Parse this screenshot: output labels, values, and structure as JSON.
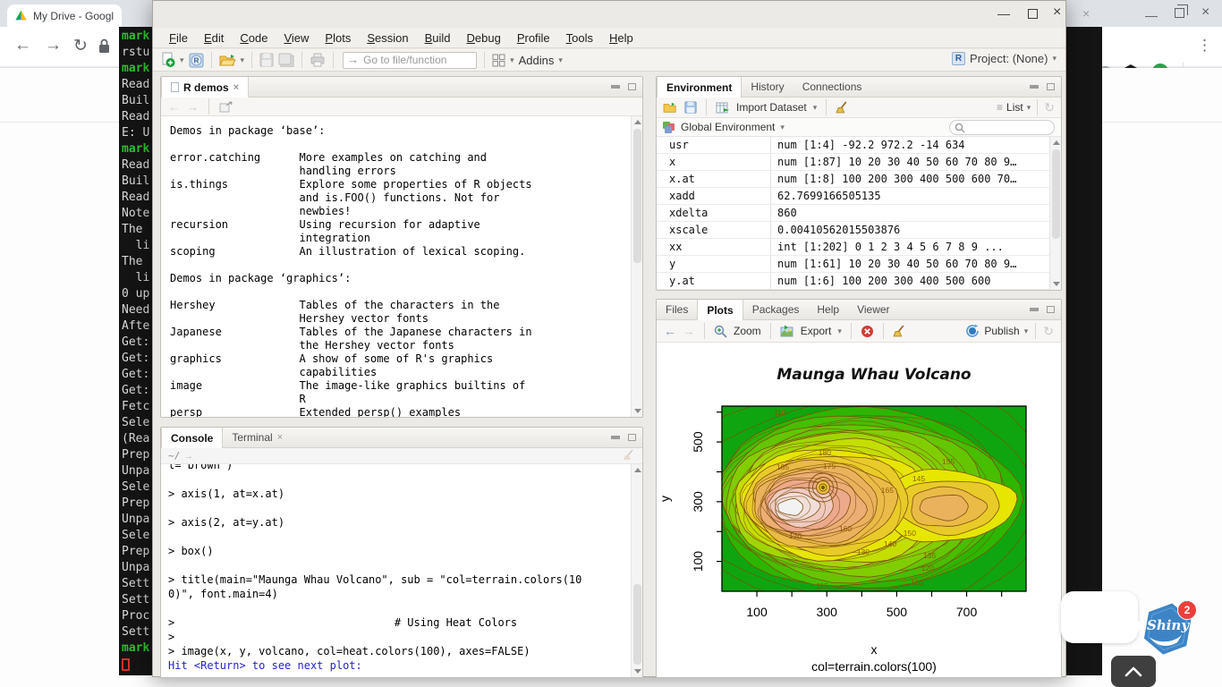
{
  "icons": {
    "back": "←",
    "forward": "→",
    "reload": "↻",
    "refresh": "↻",
    "minimize": "—",
    "close": "×",
    "tab_close": "×",
    "kebab": "⋮",
    "caret": "▾",
    "list": "≡",
    "goto_arrow": "→",
    "prompt_arrow": "→",
    "project_r": "R"
  },
  "browser": {
    "tab_title": "My Drive - Google"
  },
  "terminal": {
    "lines": [
      {
        "text": "mark",
        "color": "g"
      },
      {
        "text": "rstu",
        "color": "w"
      },
      {
        "text": "mark",
        "color": "g"
      },
      {
        "text": "Read",
        "color": "w"
      },
      {
        "text": "Buil",
        "color": "w"
      },
      {
        "text": "Read",
        "color": "w"
      },
      {
        "text": "E: U",
        "color": "w"
      },
      {
        "text": "mark",
        "color": "g"
      },
      {
        "text": "Read",
        "color": "w"
      },
      {
        "text": "Buil",
        "color": "w"
      },
      {
        "text": "Read",
        "color": "w"
      },
      {
        "text": "Note",
        "color": "w"
      },
      {
        "text": "The",
        "color": "w"
      },
      {
        "text": "  li",
        "color": "w"
      },
      {
        "text": "The",
        "color": "w"
      },
      {
        "text": "  li",
        "color": "w"
      },
      {
        "text": "0 up",
        "color": "w"
      },
      {
        "text": "Need",
        "color": "w"
      },
      {
        "text": "Afte",
        "color": "w"
      },
      {
        "text": "Get:",
        "color": "w"
      },
      {
        "text": "Get:",
        "color": "w"
      },
      {
        "text": "Get:",
        "color": "w"
      },
      {
        "text": "Get:",
        "color": "w"
      },
      {
        "text": "Fetc",
        "color": "w"
      },
      {
        "text": "Sele",
        "color": "w"
      },
      {
        "text": "(Rea",
        "color": "w"
      },
      {
        "text": "Prep",
        "color": "w"
      },
      {
        "text": "Unpa",
        "color": "w"
      },
      {
        "text": "Sele",
        "color": "w"
      },
      {
        "text": "Prep",
        "color": "w"
      },
      {
        "text": "Unpa",
        "color": "w"
      },
      {
        "text": "Sele",
        "color": "w"
      },
      {
        "text": "Prep",
        "color": "w"
      },
      {
        "text": "Unpa",
        "color": "w"
      },
      {
        "text": "Sett",
        "color": "w"
      },
      {
        "text": "Sett",
        "color": "w"
      },
      {
        "text": "Proc",
        "color": "w"
      },
      {
        "text": "Sett",
        "color": "w"
      },
      {
        "text": "mark",
        "color": "g"
      }
    ]
  },
  "rstudio": {
    "menus": [
      "File",
      "Edit",
      "Code",
      "View",
      "Plots",
      "Session",
      "Build",
      "Debug",
      "Profile",
      "Tools",
      "Help"
    ],
    "toolbar": {
      "goto_placeholder": "Go to file/function",
      "addins_label": "Addins",
      "project_label": "Project: (None)"
    },
    "source_pane": {
      "tab_label": "R demos",
      "lines": [
        "Demos in package ‘base’:",
        "",
        "error.catching      More examples on catching and",
        "                    handling errors",
        "is.things           Explore some properties of R objects",
        "                    and is.FOO() functions. Not for",
        "                    newbies!",
        "recursion           Using recursion for adaptive",
        "                    integration",
        "scoping             An illustration of lexical scoping.",
        "",
        "Demos in package ‘graphics’:",
        "",
        "Hershey             Tables of the characters in the",
        "                    Hershey vector fonts",
        "Japanese            Tables of the Japanese characters in",
        "                    the Hershey vector fonts",
        "graphics            A show of some of R's graphics",
        "                    capabilities",
        "image               The image-like graphics builtins of",
        "                    R",
        "persp               Extended persp() examples"
      ]
    },
    "console_pane": {
      "tabs": [
        {
          "label": "Console",
          "active": true,
          "closable": false
        },
        {
          "label": "Terminal",
          "active": false,
          "closable": true
        }
      ],
      "path": "~/",
      "lines": [
        {
          "text": "l=\"brown\")",
          "kind": "clip"
        },
        {
          "text": "",
          "kind": "cmd"
        },
        {
          "text": "> axis(1, at=x.at)",
          "kind": "cmd"
        },
        {
          "text": "",
          "kind": "cmd"
        },
        {
          "text": "> axis(2, at=y.at)",
          "kind": "cmd"
        },
        {
          "text": "",
          "kind": "cmd"
        },
        {
          "text": "> box()",
          "kind": "cmd"
        },
        {
          "text": "",
          "kind": "cmd"
        },
        {
          "text": "> title(main=\"Maunga Whau Volcano\", sub = \"col=terrain.colors(10",
          "kind": "cmd"
        },
        {
          "text": "0)\", font.main=4)",
          "kind": "cmd"
        },
        {
          "text": "",
          "kind": "cmd"
        },
        {
          "text": ">                                  # Using Heat Colors",
          "kind": "cmd"
        },
        {
          "text": ">",
          "kind": "cmd"
        },
        {
          "text": "> image(x, y, volcano, col=heat.colors(100), axes=FALSE)",
          "kind": "cmd"
        },
        {
          "text": "Hit <Return> to see next plot:",
          "kind": "msg"
        }
      ]
    },
    "env_pane": {
      "tabs": [
        {
          "label": "Environment",
          "active": true
        },
        {
          "label": "History",
          "active": false
        },
        {
          "label": "Connections",
          "active": false
        }
      ],
      "import_label": "Import Dataset",
      "list_label": "List",
      "scope_label": "Global Environment",
      "rows": [
        {
          "name": "usr",
          "value": "num [1:4] -92.2 972.2 -14 634"
        },
        {
          "name": "x",
          "value": "num [1:87] 10 20 30 40 50 60 70 80 9…"
        },
        {
          "name": "x.at",
          "value": "num [1:8] 100 200 300 400 500 600 70…"
        },
        {
          "name": "xadd",
          "value": "62.7699166505135"
        },
        {
          "name": "xdelta",
          "value": "860"
        },
        {
          "name": "xscale",
          "value": "0.00410562015503876"
        },
        {
          "name": "xx",
          "value": "int [1:202] 0 1 2 3 4 5 6 7 8 9 ..."
        },
        {
          "name": "y",
          "value": "num [1:61] 10 20 30 40 50 60 70 80 9…"
        },
        {
          "name": "y.at",
          "value": "num [1:6] 100 200 300 400 500 600"
        }
      ]
    },
    "plots_pane": {
      "tabs": [
        {
          "label": "Files",
          "active": false
        },
        {
          "label": "Plots",
          "active": true
        },
        {
          "label": "Packages",
          "active": false
        },
        {
          "label": "Help",
          "active": false
        },
        {
          "label": "Viewer",
          "active": false
        }
      ],
      "zoom_label": "Zoom",
      "export_label": "Export",
      "publish_label": "Publish"
    }
  },
  "chart_data": {
    "type": "heatmap",
    "variant": "filled-contour-map",
    "title": "Maunga Whau Volcano",
    "xlabel": "x",
    "ylabel": "y",
    "subtitle": "col=terrain.colors(100)",
    "palette_name": "terrain.colors(100)",
    "x_range": [
      0,
      870
    ],
    "y_range": [
      0,
      620
    ],
    "x_ticks": [
      100,
      200,
      300,
      400,
      500,
      600,
      700,
      800
    ],
    "x_tick_labels": [
      100,
      300,
      500,
      700
    ],
    "y_ticks": [
      100,
      200,
      300,
      400,
      500,
      600
    ],
    "y_tick_labels": [
      100,
      300,
      500
    ],
    "z_range": [
      94,
      195
    ],
    "contour_interval": 5,
    "base_color": "#0FA50F",
    "contour_color": "#7E4E0E",
    "label_color": "#8A5200",
    "palette": [
      "#2DB600",
      "#47BE00",
      "#63C600",
      "#81CE00",
      "#A0D600",
      "#C3DE00",
      "#E6E600",
      "#E8CB28",
      "#EABB47",
      "#EBB25E",
      "#ECAE75",
      "#EDA98C",
      "#F0C9C0",
      "#F1DED9",
      "#F2F2F2"
    ],
    "contour_labels": [
      {
        "level": 180,
        "x": 294,
        "y": 455
      },
      {
        "level": 175,
        "x": 307,
        "y": 410
      },
      {
        "level": 185,
        "x": 174,
        "y": 408
      },
      {
        "level": 165,
        "x": 473,
        "y": 329
      },
      {
        "level": 145,
        "x": 563,
        "y": 368
      },
      {
        "level": 160,
        "x": 353,
        "y": 200
      },
      {
        "level": 170,
        "x": 210,
        "y": 177
      },
      {
        "level": 150,
        "x": 537,
        "y": 186
      },
      {
        "level": 140,
        "x": 481,
        "y": 150
      },
      {
        "level": 130,
        "x": 404,
        "y": 123
      },
      {
        "level": 135,
        "x": 594,
        "y": 111
      },
      {
        "level": 120,
        "x": 588,
        "y": 69
      },
      {
        "level": 110,
        "x": 558,
        "y": 21
      },
      {
        "level": 115,
        "x": 287,
        "y": 9
      },
      {
        "level": 155,
        "x": 648,
        "y": 425
      },
      {
        "level": 110,
        "x": 166,
        "y": 590
      }
    ]
  },
  "overlay": {
    "shiny_text": "Shiny",
    "badge": "2"
  }
}
